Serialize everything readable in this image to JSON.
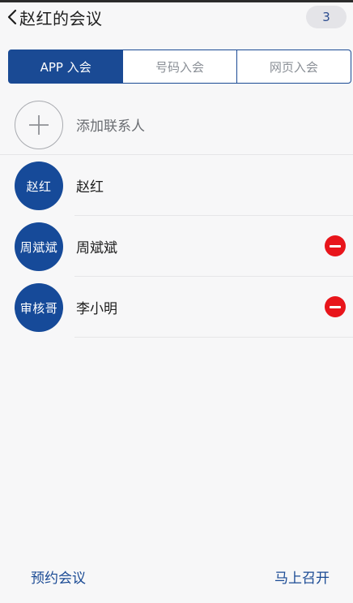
{
  "header": {
    "title": "赵红的会议",
    "count": "3"
  },
  "tabs": [
    {
      "label": "APP 入会",
      "active": true
    },
    {
      "label": "号码入会",
      "active": false
    },
    {
      "label": "网页入会",
      "active": false
    }
  ],
  "add_contact": {
    "label": "添加联系人",
    "icon": "plus-icon"
  },
  "participants": [
    {
      "avatar_text": "赵红",
      "name": "赵红",
      "removable": false
    },
    {
      "avatar_text": "周斌斌",
      "name": "周斌斌",
      "removable": true
    },
    {
      "avatar_text": "审核哥",
      "name": "李小明",
      "removable": true
    }
  ],
  "footer": {
    "schedule_label": "预约会议",
    "start_label": "马上召开"
  },
  "colors": {
    "brand": "#1a4a94",
    "remove": "#e8151b"
  }
}
